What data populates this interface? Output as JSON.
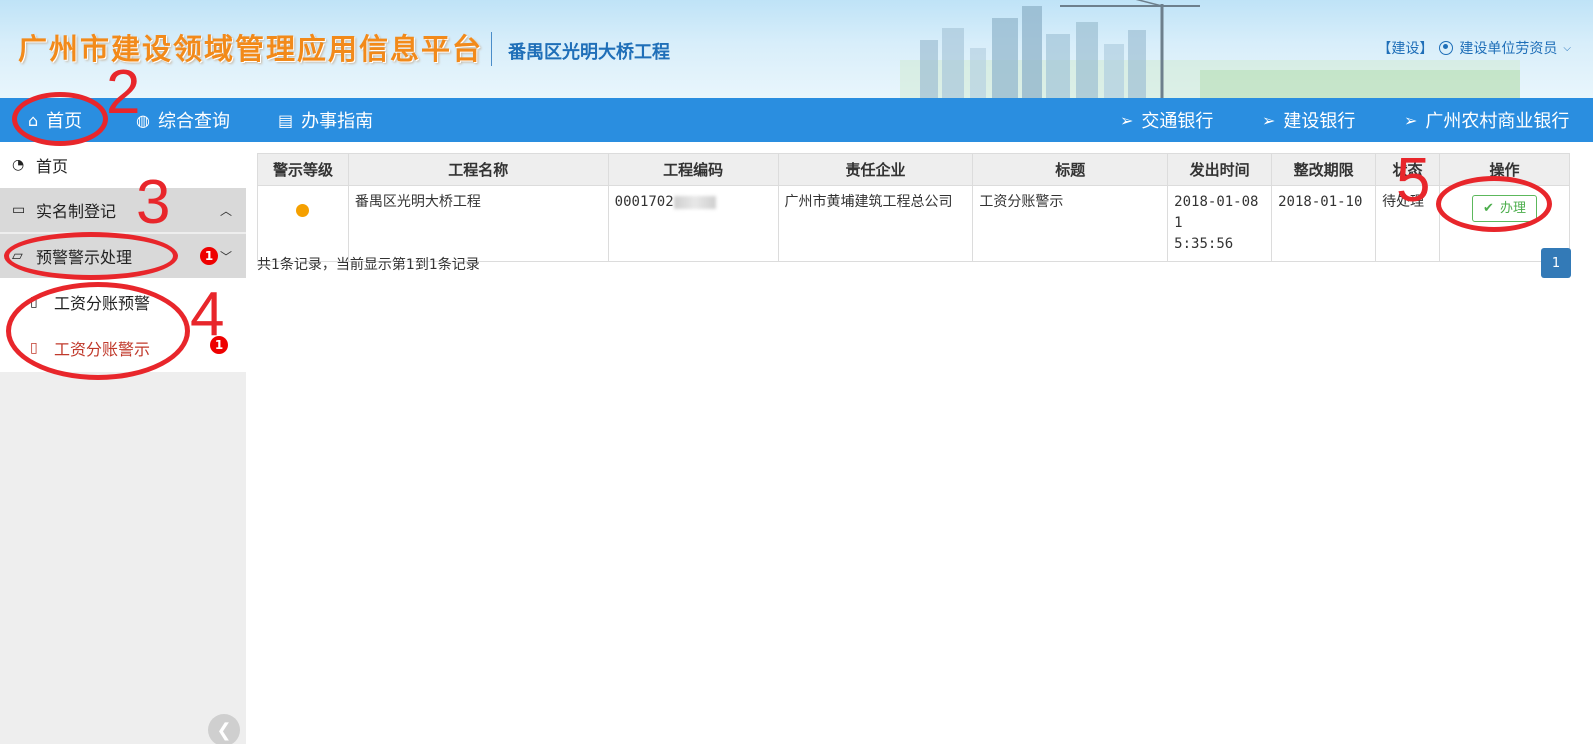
{
  "header": {
    "brand_title": "广州市建设领域管理应用信息平台",
    "project_name": "番禺区光明大桥工程",
    "role_tag": "【建设】",
    "user_name": "建设单位劳资员"
  },
  "nav": {
    "left": [
      {
        "label": "首页",
        "icon": "home-icon"
      },
      {
        "label": "综合查询",
        "icon": "globe-icon"
      },
      {
        "label": "办事指南",
        "icon": "book-icon"
      }
    ],
    "right": [
      {
        "label": "交通银行",
        "icon": "send-icon"
      },
      {
        "label": "建设银行",
        "icon": "send-icon"
      },
      {
        "label": "广州农村商业银行",
        "icon": "send-icon"
      }
    ]
  },
  "sidebar": {
    "home": "首页",
    "group1": "实名制登记",
    "group2": "预警警示处理",
    "group2_badge": "1",
    "sub1": "工资分账预警",
    "sub2": "工资分账警示",
    "sub2_badge": "1"
  },
  "table": {
    "headers": [
      "警示等级",
      "工程名称",
      "工程编码",
      "责任企业",
      "标题",
      "发出时间",
      "整改期限",
      "状态",
      "操作"
    ],
    "rows": [
      {
        "level_color": "#f5a000",
        "project_name": "番禺区光明大桥工程",
        "project_code": "0001702",
        "company": "广州市黄埔建筑工程总公司",
        "title": "工资分账警示",
        "issue_time_line1": "2018-01-08 1",
        "issue_time_line2": "5:35:56",
        "deadline": "2018-01-10",
        "status": "待处理",
        "action": "办理"
      }
    ]
  },
  "summary": "共1条记录，当前显示第1到1条记录",
  "pager": {
    "current": "1"
  },
  "annotations": [
    "2",
    "3",
    "4",
    "5"
  ],
  "colors": {
    "nav": "#2a8ee0",
    "annotation": "#e8262b",
    "brand": "#f28a1a"
  }
}
